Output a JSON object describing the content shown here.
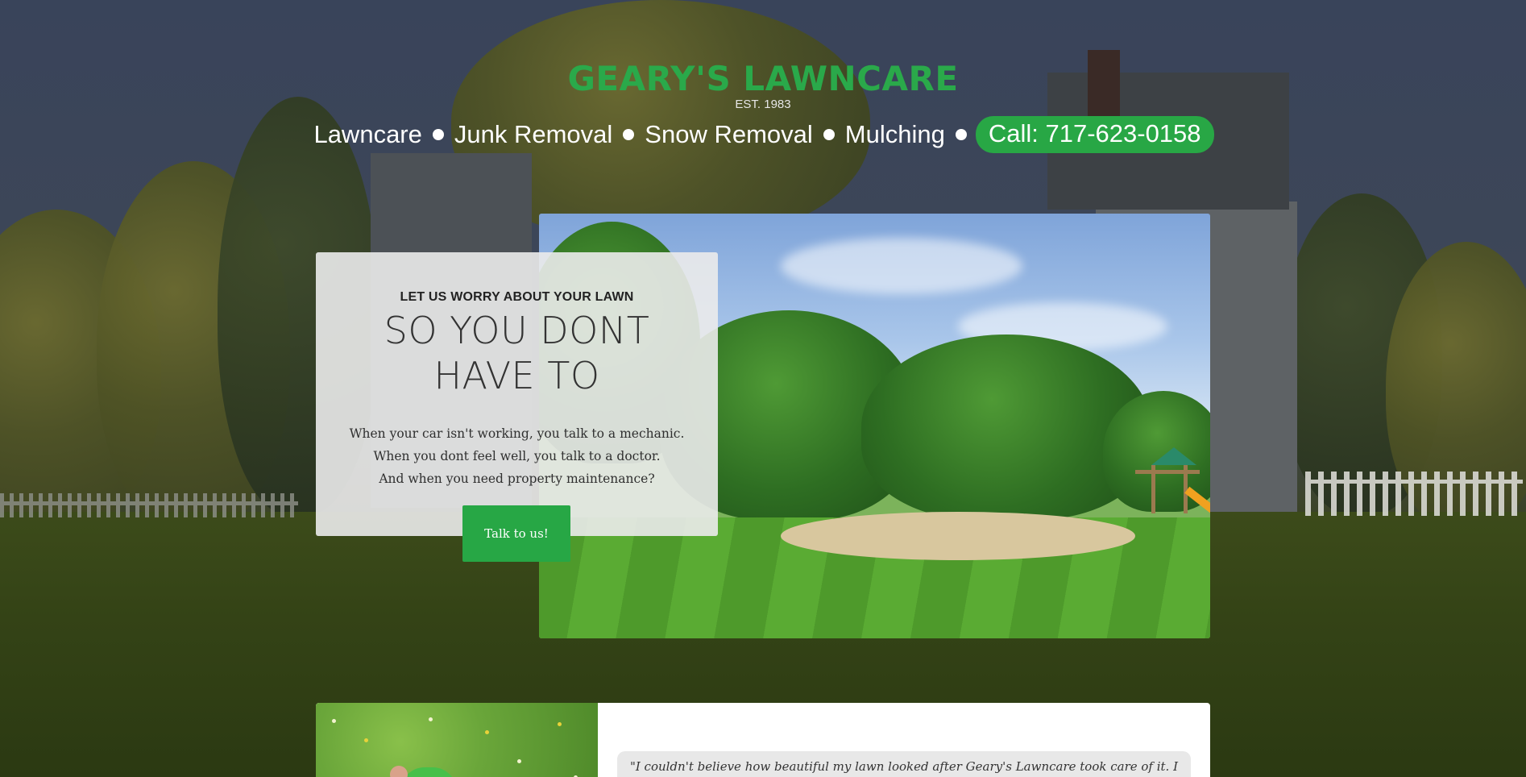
{
  "brand": {
    "name": "GEARY'S LAWNCARE",
    "established": "EST. 1983"
  },
  "nav": {
    "items": [
      "Lawncare",
      "Junk Removal",
      "Snow Removal",
      "Mulching"
    ],
    "call_label": "Call: 717-623-0158"
  },
  "hero": {
    "kicker": "LET US WORRY ABOUT YOUR LAWN",
    "heading": "SO YOU DONT HAVE TO",
    "body_lines": [
      "When your car isn't working, you talk to a mechanic.",
      "When you dont feel well, you talk to a doctor.",
      "And when you need property maintenance?"
    ],
    "button_label": "Talk to us!"
  },
  "testimonial": {
    "quote": "\"I couldn't believe how beautiful my lawn looked after Geary's Lawncare took care of it. I"
  },
  "colors": {
    "brand_green": "#2aa94a",
    "button_green": "#27a745",
    "card_bg": "#ebebeb",
    "overlay": "#2b3445"
  }
}
